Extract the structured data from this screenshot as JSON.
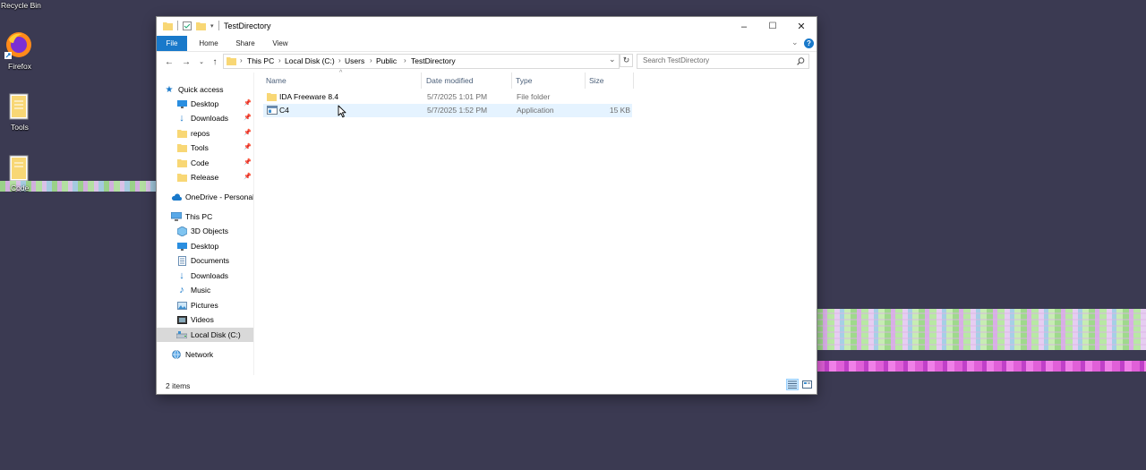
{
  "desktop": {
    "icons": [
      {
        "label": "Recycle Bin",
        "icon": "recycle-bin-icon"
      },
      {
        "label": "Firefox",
        "icon": "firefox-icon"
      },
      {
        "label": "Tools",
        "icon": "text-file-icon"
      },
      {
        "label": "Code",
        "icon": "text-file-icon"
      }
    ]
  },
  "window": {
    "title": "TestDirectory",
    "controls": {
      "minimize": "–",
      "maximize": "☐",
      "close": "✕"
    },
    "ribbon": {
      "tabs": [
        "File",
        "Home",
        "Share",
        "View"
      ],
      "collapse_icon": "chevron-down-icon",
      "help_label": "?"
    },
    "address": {
      "crumbs": [
        "This PC",
        "Local Disk (C:)",
        "Users",
        "Public",
        "TestDirectory"
      ],
      "search_placeholder": "Search TestDirectory"
    },
    "nav_pane": {
      "quick_access": "Quick access",
      "quick_items": [
        {
          "label": "Desktop",
          "icon": "desktop-icon"
        },
        {
          "label": "Downloads",
          "icon": "downloads-icon"
        },
        {
          "label": "repos",
          "icon": "folder-icon"
        },
        {
          "label": "Tools",
          "icon": "folder-icon"
        },
        {
          "label": "Code",
          "icon": "folder-icon"
        },
        {
          "label": "Release",
          "icon": "folder-icon"
        }
      ],
      "onedrive": "OneDrive - Personal",
      "this_pc": "This PC",
      "pc_items": [
        {
          "label": "3D Objects",
          "icon": "3d-objects-icon"
        },
        {
          "label": "Desktop",
          "icon": "desktop-icon"
        },
        {
          "label": "Documents",
          "icon": "documents-icon"
        },
        {
          "label": "Downloads",
          "icon": "downloads-icon"
        },
        {
          "label": "Music",
          "icon": "music-icon"
        },
        {
          "label": "Pictures",
          "icon": "pictures-icon"
        },
        {
          "label": "Videos",
          "icon": "videos-icon"
        },
        {
          "label": "Local Disk (C:)",
          "icon": "drive-icon"
        }
      ],
      "network": "Network"
    },
    "columns": [
      "Name",
      "Date modified",
      "Type",
      "Size"
    ],
    "files": [
      {
        "name": "IDA Freeware 8.4",
        "date": "5/7/2025 1:01 PM",
        "type": "File folder",
        "size": "",
        "icon": "folder-icon"
      },
      {
        "name": "C4",
        "date": "5/7/2025 1:52 PM",
        "type": "Application",
        "size": "15 KB",
        "icon": "application-icon"
      }
    ],
    "status": "2 items"
  },
  "colors": {
    "accent": "#1979ca",
    "folder": "#f8d775",
    "desktop_bg": "#3b3a52",
    "hover_row": "#e5f3ff"
  }
}
